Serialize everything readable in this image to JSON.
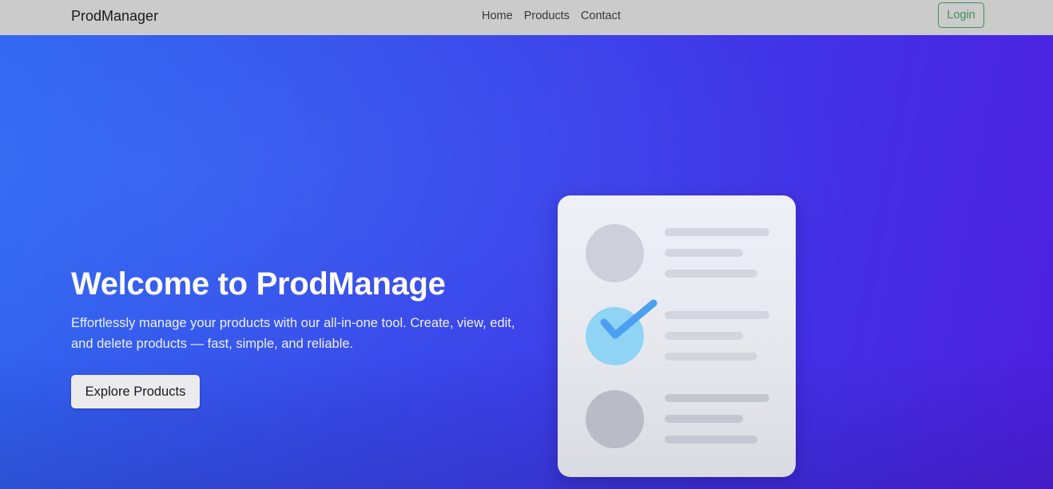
{
  "navbar": {
    "brand": "ProdManager",
    "links": [
      "Home",
      "Products",
      "Contact"
    ],
    "login_label": "Login"
  },
  "hero": {
    "title": "Welcome to ProdManage",
    "subtitle": "Effortlessly manage your products with our all-in-one tool. Create, view, edit, and delete products — fast, simple, and reliable.",
    "cta_label": "Explore Products"
  },
  "illustration": {
    "icon": "checklist-document-icon",
    "rows": [
      {
        "icon": "placeholder-circle-icon",
        "state": "unchecked"
      },
      {
        "icon": "checkmark-icon",
        "state": "checked"
      },
      {
        "icon": "placeholder-circle-icon",
        "state": "unchecked"
      }
    ]
  },
  "colors": {
    "navbar_bg": "#cbcbcb",
    "hero_gradient_start": "#2f65ef",
    "hero_gradient_end": "#4d20de",
    "login_accent": "#3e8d5f",
    "check_circle": "#8fd3f5",
    "check_mark": "#4b9ef0"
  }
}
